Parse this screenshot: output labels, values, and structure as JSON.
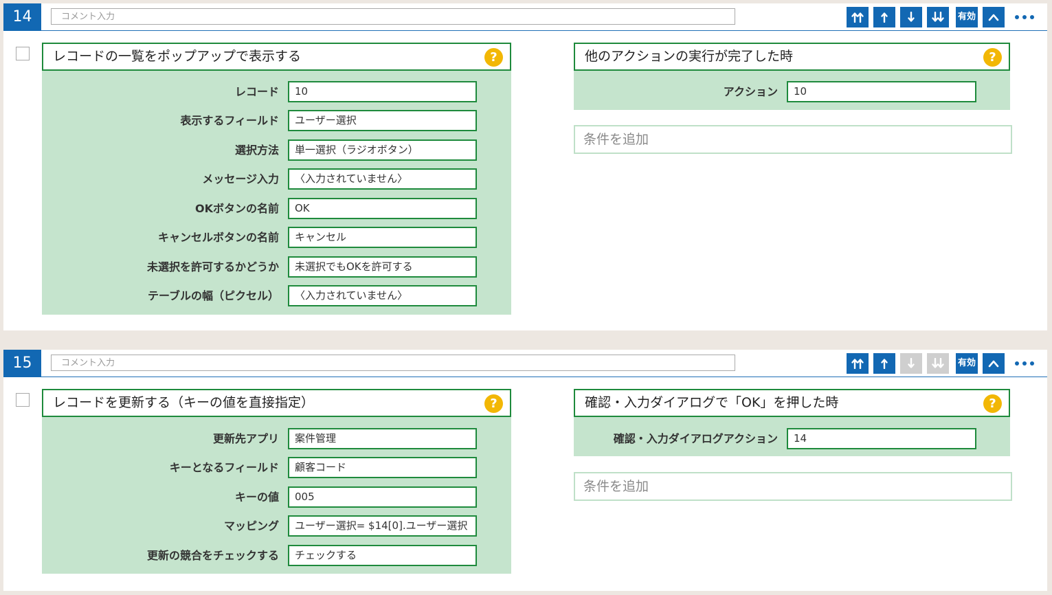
{
  "colors": {
    "primary_blue": "#1268b3",
    "green_border": "#1e8a3c",
    "panel_green": "#c5e4cd",
    "help_yellow": "#f2b705",
    "page_bg": "#ede7e1",
    "disabled_gray": "#cfcfcf"
  },
  "blocks": [
    {
      "number": "14",
      "comment_placeholder": "コメント入力",
      "toolbar": {
        "move_top_icon": "double-up-arrow-icon",
        "move_up_icon": "up-arrow-icon",
        "move_down_icon": "down-arrow-icon",
        "move_bottom_icon": "double-down-arrow-icon",
        "enabled_label": "有効",
        "collapse_icon": "chevron-up-icon",
        "more_icon": "more-dots-icon",
        "move_down_disabled": false,
        "move_bottom_disabled": false
      },
      "action": {
        "title": "レコードの一覧をポップアップで表示する",
        "help_label": "?",
        "fields": [
          {
            "label": "レコード",
            "value": "10"
          },
          {
            "label": "表示するフィールド",
            "value": "ユーザー選択"
          },
          {
            "label": "選択方法",
            "value": "単一選択（ラジオボタン）"
          },
          {
            "label": "メッセージ入力",
            "value": "〈入力されていません〉"
          },
          {
            "label": "OKボタンの名前",
            "value": "OK"
          },
          {
            "label": "キャンセルボタンの名前",
            "value": "キャンセル"
          },
          {
            "label": "未選択を許可するかどうか",
            "value": "未選択でもOKを許可する"
          },
          {
            "label": "テーブルの幅（ピクセル）",
            "value": "〈入力されていません〉"
          }
        ]
      },
      "trigger": {
        "title": "他のアクションの実行が完了した時",
        "help_label": "?",
        "fields": [
          {
            "label": "アクション",
            "value": "10"
          }
        ],
        "add_condition": "条件を追加"
      }
    },
    {
      "number": "15",
      "comment_placeholder": "コメント入力",
      "toolbar": {
        "move_top_icon": "double-up-arrow-icon",
        "move_up_icon": "up-arrow-icon",
        "move_down_icon": "down-arrow-icon",
        "move_bottom_icon": "double-down-arrow-icon",
        "enabled_label": "有効",
        "collapse_icon": "chevron-up-icon",
        "more_icon": "more-dots-icon",
        "move_down_disabled": true,
        "move_bottom_disabled": true
      },
      "action": {
        "title": "レコードを更新する（キーの値を直接指定）",
        "help_label": "?",
        "fields": [
          {
            "label": "更新先アプリ",
            "value": "案件管理"
          },
          {
            "label": "キーとなるフィールド",
            "value": "顧客コード"
          },
          {
            "label": "キーの値",
            "value": "005"
          },
          {
            "label": "マッピング",
            "value": "ユーザー選択= $14[0].ユーザー選択"
          },
          {
            "label": "更新の競合をチェックする",
            "value": "チェックする"
          }
        ]
      },
      "trigger": {
        "title": "確認・入力ダイアログで「OK」を押した時",
        "help_label": "?",
        "fields": [
          {
            "label": "確認・入力ダイアログアクション",
            "value": "14"
          }
        ],
        "add_condition": "条件を追加"
      }
    }
  ]
}
